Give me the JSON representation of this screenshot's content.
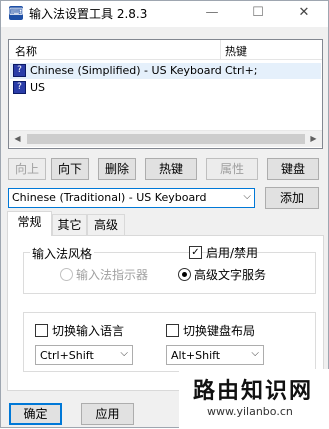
{
  "window": {
    "title": "输入法设置工具 2.8.3",
    "app_icon": "keyboard-app-icon"
  },
  "titlebar": {
    "minimize": "—",
    "maximize": "☐",
    "close": "✕"
  },
  "list": {
    "columns": [
      "名称",
      "热键"
    ],
    "rows": [
      {
        "name": "Chinese (Simplified) - US Keyboard",
        "hotkey": "Ctrl+;",
        "selected": true
      },
      {
        "name": "US",
        "hotkey": "",
        "selected": false
      }
    ],
    "scroll_left": "◀",
    "scroll_right": "▶"
  },
  "buttons": {
    "up": "向上",
    "down": "向下",
    "delete": "删除",
    "hotkey": "热键",
    "properties": "属性",
    "keyboard": "键盘",
    "add": "添加",
    "ok": "确定",
    "apply": "应用"
  },
  "layout_select": {
    "value": "Chinese (Traditional) - US Keyboard",
    "arrow": "⌵"
  },
  "tabs": [
    "常规",
    "其它",
    "高级"
  ],
  "general": {
    "style_label": "输入法风格",
    "enable_label": "启用/禁用",
    "enable_checked": true,
    "radio_indicator": "输入法指示器",
    "radio_advanced": "高级文字服务",
    "switch_lang_label": "切换输入语言",
    "switch_lang_checked": false,
    "switch_lang_value": "Ctrl+Shift",
    "switch_layout_label": "切换键盘布局",
    "switch_layout_checked": false,
    "switch_layout_value": "Alt+Shift"
  },
  "watermark": {
    "title": "路由知识网",
    "subtitle": "www.yilanbo.cn"
  },
  "colors": {
    "accent": "#0078d7",
    "selection": "#e5f0fb"
  }
}
